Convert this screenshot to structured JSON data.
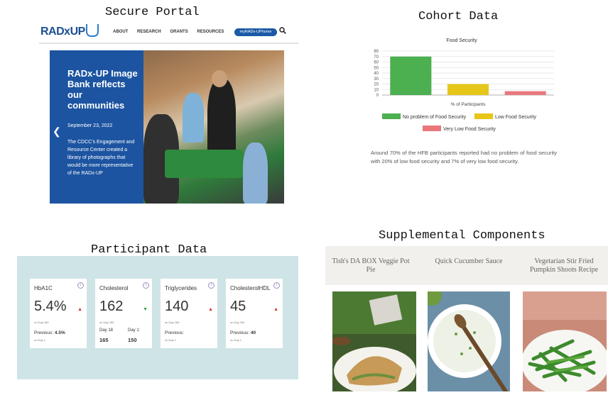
{
  "sections": {
    "portal_title": "Secure Portal",
    "cohort_title": "Cohort Data",
    "participant_title": "Participant Data",
    "supplemental_title": "Supplemental Components"
  },
  "portal": {
    "logo": "RADxUP",
    "nav": [
      "ABOUT",
      "RESEARCH",
      "GRANTS",
      "RESOURCES"
    ],
    "portal_button": "myRADx-UPhome",
    "hero_title": "RADx-UP Image Bank reflects our communities",
    "hero_date": "September 23, 2022",
    "hero_text": "The CDCC's Engagement and Resource Center created a library of photographs that would be more representative of the RADx-UP"
  },
  "cohort": {
    "paragraph": "Around 70% of the HFB participants reported had no problem of food security with 20% of low food security and 7% of very low food security."
  },
  "chart_data": {
    "type": "bar",
    "title": "Food Security",
    "xlabel": "% of Participants",
    "ylim": [
      0,
      80
    ],
    "yticks": [
      0,
      10,
      20,
      30,
      40,
      50,
      60,
      70,
      80
    ],
    "grid": true,
    "legend_position": "bottom",
    "series": [
      {
        "name": "No problem of Food Security",
        "value": 70,
        "color": "#4caf50"
      },
      {
        "name": "Low Food Security",
        "value": 20,
        "color": "#e6c619"
      },
      {
        "name": "Very Low Food Security",
        "value": 7,
        "color": "#e8787c"
      }
    ]
  },
  "participant": {
    "cards": [
      {
        "name": "HbA1C",
        "value": "5.4%",
        "trend": "up",
        "sub": "on Day 180",
        "prev_label": "Previous:",
        "prev_value": "4.5%",
        "prev_sub": "on Day 1"
      },
      {
        "name": "Cholesterol",
        "value": "162",
        "trend": "down",
        "sub": "on Day 180",
        "day_a_label": "Day 18",
        "day_a_value": "165",
        "day_b_label": "Day 1:",
        "day_b_value": "150"
      },
      {
        "name": "Triglycerides",
        "value": "140",
        "trend": "up",
        "sub": "on Day 180",
        "prev_label": "Previous:",
        "prev_value": "",
        "prev_sub": "on Day 1"
      },
      {
        "name": "CholesterolHDL",
        "value": "45",
        "trend": "up",
        "sub": "on Day 180",
        "prev_label": "Previous:",
        "prev_value": "40",
        "prev_sub": "on Day 1"
      }
    ],
    "colors": {
      "up": "#d9342b",
      "down": "#2e9e3e"
    }
  },
  "supplemental": {
    "recipes": [
      "Tish's DA BOX Veggie Pot Pie",
      "Quick Cucumber Sauce",
      "Vegetarian Stir Fried Pumpkin Shoots Recipe"
    ]
  }
}
